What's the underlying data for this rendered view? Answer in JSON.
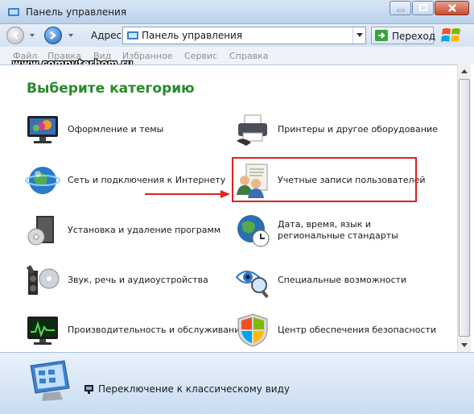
{
  "window": {
    "title": "Панель управления"
  },
  "address": {
    "label": "Адрес:",
    "value": "Панель управления",
    "go_label": "Переход"
  },
  "menu": {
    "items": [
      "Файл",
      "Правка",
      "Вид",
      "Избранное",
      "Сервис",
      "Справка"
    ]
  },
  "watermark": "www.computerhom.ru",
  "heading": "Выберите категорию",
  "categories": {
    "appearance": "Оформление и темы",
    "network": "Сеть и подключения к Интернету",
    "programs": "Установка и удаление программ",
    "sound": "Звук, речь и аудиоустройства",
    "performance": "Производительность и обслуживание",
    "printers": "Принтеры и другое оборудование",
    "accounts": "Учетные записи пользователей",
    "datetime": "Дата, время, язык и региональные стандарты",
    "accessibility": "Специальные возможности",
    "security": "Центр обеспечения безопасности"
  },
  "footer": {
    "link": "Переключение к классическому виду"
  },
  "colors": {
    "heading": "#278a2a",
    "highlight": "#e02020",
    "arrow": "#e02020"
  }
}
